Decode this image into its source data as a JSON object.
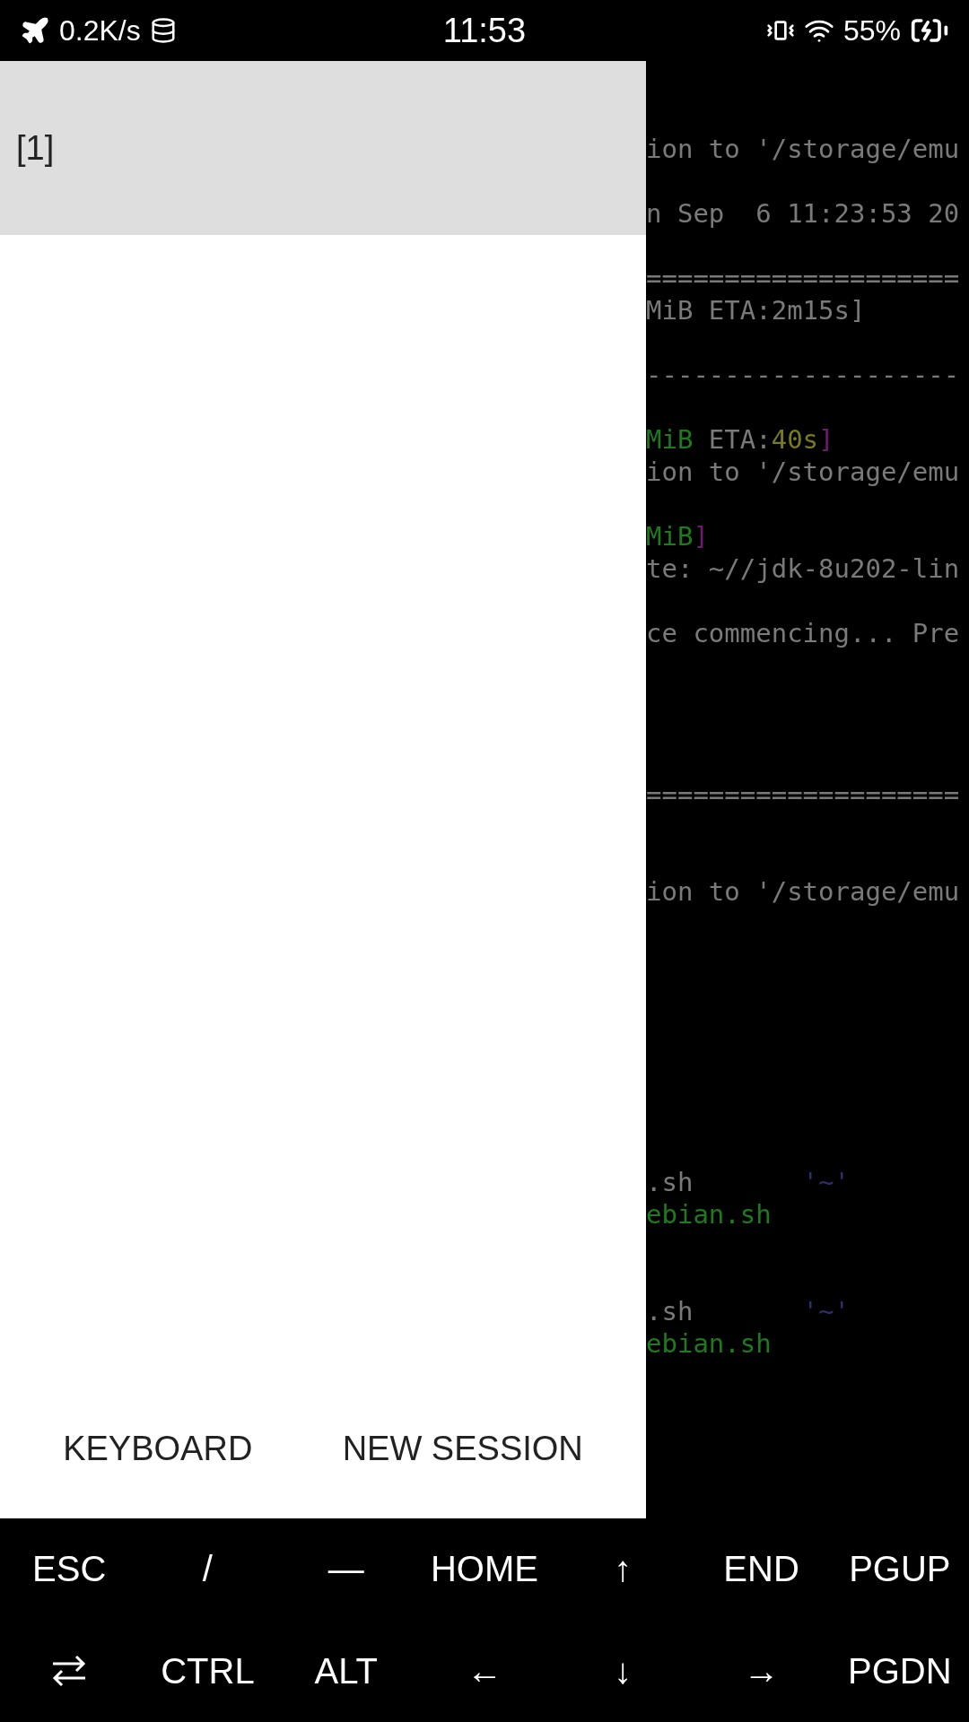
{
  "status_bar": {
    "speed": "0.2K/s",
    "time": "11:53",
    "battery": "55%"
  },
  "terminal": {
    "lines": [
      {
        "segments": [
          {
            "text": "ion to '/storage/emu",
            "color": "#7a7a7a"
          }
        ]
      },
      {
        "segments": [
          {
            "text": "n Sep  6 11:23:53 20",
            "color": "#7a7a7a"
          }
        ]
      },
      {
        "segments": [
          {
            "text": "====================",
            "color": "#7a7a7a"
          }
        ]
      },
      {
        "segments": [
          {
            "text": "MiB ETA:2m15s]",
            "color": "#7a7a7a"
          }
        ]
      },
      {
        "segments": [
          {
            "text": "--------------------",
            "color": "#7a7a7a"
          }
        ]
      },
      {
        "segments": [
          {
            "text": "MiB",
            "color": "#1f7a1f"
          },
          {
            "text": " ETA:",
            "color": "#7a7a7a"
          },
          {
            "text": "40s",
            "color": "#7a7a1f"
          },
          {
            "text": "]",
            "color": "#6e1a6e"
          }
        ]
      },
      {
        "segments": [
          {
            "text": "ion to '/storage/emu",
            "color": "#7a7a7a"
          }
        ]
      },
      {
        "segments": [
          {
            "text": "MiB",
            "color": "#1f7a1f"
          },
          {
            "text": "]",
            "color": "#6e1a6e"
          }
        ]
      },
      {
        "segments": [
          {
            "text": "te: ~//jdk-8u202-lin",
            "color": "#7a7a7a"
          }
        ]
      },
      {
        "segments": [
          {
            "text": "ce commencing... Pre",
            "color": "#7a7a7a"
          }
        ]
      },
      {
        "segments": [
          {
            "text": "====================",
            "color": "#7a7a7a"
          }
        ]
      },
      {
        "segments": [
          {
            "text": "ion to '/storage/emu",
            "color": "#7a7a7a"
          }
        ]
      },
      {
        "segments": [
          {
            "text": ".sh       ",
            "color": "#7a7a7a"
          },
          {
            "text": "'~'",
            "color": "#2e2e6e"
          }
        ]
      },
      {
        "segments": [
          {
            "text": "ebian.sh",
            "color": "#1f7a1f"
          }
        ]
      },
      {
        "segments": [
          {
            "text": ".sh       ",
            "color": "#7a7a7a"
          },
          {
            "text": "'~'",
            "color": "#2e2e6e"
          }
        ]
      },
      {
        "segments": [
          {
            "text": "ebian.sh",
            "color": "#1f7a1f"
          }
        ]
      }
    ]
  },
  "drawer": {
    "sessions": [
      {
        "label": "[1]",
        "selected": true
      }
    ],
    "buttons": [
      "KEYBOARD",
      "NEW SESSION"
    ]
  },
  "extra_keys": [
    {
      "kind": "text",
      "label": "ESC"
    },
    {
      "kind": "text",
      "label": "/"
    },
    {
      "kind": "text",
      "label": "—"
    },
    {
      "kind": "text",
      "label": "HOME"
    },
    {
      "kind": "text",
      "label": "↑"
    },
    {
      "kind": "text",
      "label": "END"
    },
    {
      "kind": "text",
      "label": "PGUP"
    },
    {
      "kind": "tab"
    },
    {
      "kind": "text",
      "label": "CTRL"
    },
    {
      "kind": "text",
      "label": "ALT"
    },
    {
      "kind": "text",
      "label": "←"
    },
    {
      "kind": "text",
      "label": "↓"
    },
    {
      "kind": "text",
      "label": "→"
    },
    {
      "kind": "text",
      "label": "PGDN"
    }
  ]
}
